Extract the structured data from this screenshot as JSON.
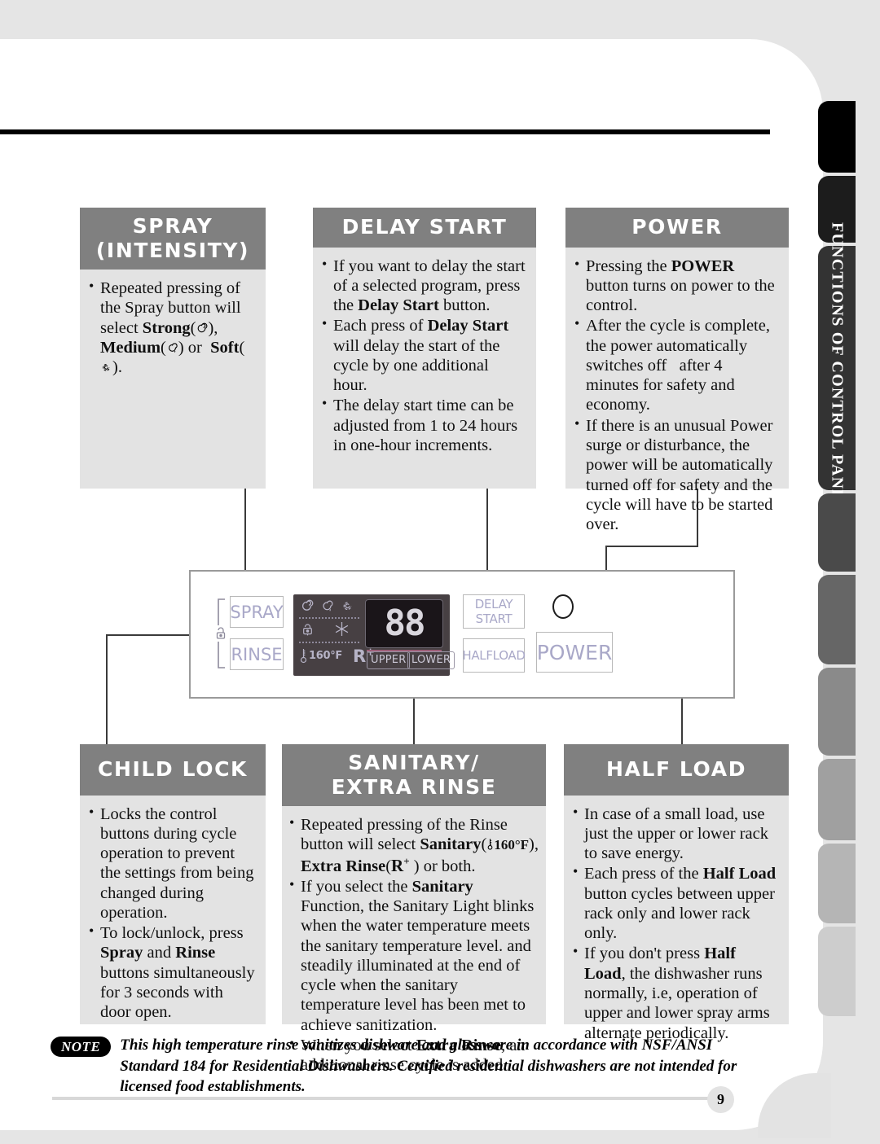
{
  "sidebar": {
    "active_tab_label": "FUNCTIONS OF CONTROL PANEL",
    "tabs": [
      {
        "name": "tab-1",
        "color": "#000000"
      },
      {
        "name": "tab-2",
        "color": "#1c1c1c"
      },
      {
        "name": "tab-3-active",
        "color": "#333333"
      },
      {
        "name": "tab-4",
        "color": "#4a4a4a"
      },
      {
        "name": "tab-5",
        "color": "#666666"
      },
      {
        "name": "tab-6",
        "color": "#8a8a8a"
      },
      {
        "name": "tab-7",
        "color": "#a0a0a0"
      },
      {
        "name": "tab-8",
        "color": "#b5b5b5"
      },
      {
        "name": "tab-9",
        "color": "#cdcdcd"
      }
    ]
  },
  "boxes": {
    "spray": {
      "title_line1": "SPRAY",
      "title_line2": "(INTENSITY)",
      "bullets": [
        {
          "segments": [
            {
              "t": "Repeated pressing of the Spray button will select ",
              "b": false
            },
            {
              "t": "Strong",
              "b": true
            },
            {
              "t": "(",
              "b": true,
              "icon": "spiral-strong-icon"
            },
            {
              "t": "), ",
              "b": true
            },
            {
              "t": "Medium",
              "b": true
            },
            {
              "t": "(",
              "b": true,
              "icon": "spiral-medium-icon"
            },
            {
              "t": ") or ",
              "b": true
            },
            {
              "t": "Soft",
              "b": true
            },
            {
              "t": "(",
              "b": true,
              "icon": "spiral-soft-icon"
            },
            {
              "t": ").",
              "b": true
            }
          ]
        }
      ]
    },
    "delay_start": {
      "title": "DELAY START",
      "bullets": [
        {
          "segments": [
            {
              "t": "If you want to delay the start of a selected program, press the ",
              "b": false
            },
            {
              "t": "Delay Start",
              "b": true
            },
            {
              "t": " button.",
              "b": false
            }
          ]
        },
        {
          "segments": [
            {
              "t": "Each press of ",
              "b": false
            },
            {
              "t": "Delay Start",
              "b": true
            },
            {
              "t": " will delay the start of the cycle by one additional hour.",
              "b": false
            }
          ]
        },
        {
          "segments": [
            {
              "t": "The delay start time can be adjusted from 1 to 24 hours in one-hour increments.",
              "b": false
            }
          ]
        }
      ]
    },
    "power": {
      "title": "POWER",
      "bullets": [
        {
          "segments": [
            {
              "t": "Pressing the ",
              "b": false
            },
            {
              "t": "POWER",
              "b": true
            },
            {
              "t": " button turns on power to the control.",
              "b": false
            }
          ]
        },
        {
          "segments": [
            {
              "t": "After the cycle is complete, the power automatically switches off   after 4 minutes for safety and economy.",
              "b": false
            }
          ]
        },
        {
          "segments": [
            {
              "t": "If there is an unusual Power surge or disturbance, the power will be automatically  turned off for safety and the cycle will have to be started over.",
              "b": false
            }
          ]
        }
      ]
    },
    "child_lock": {
      "title": "CHILD LOCK",
      "bullets": [
        {
          "segments": [
            {
              "t": "Locks the control buttons during cycle operation to prevent the settings from being changed during operation.",
              "b": false
            }
          ]
        },
        {
          "segments": [
            {
              "t": "To lock/unlock, press ",
              "b": false
            },
            {
              "t": "Spray",
              "b": true
            },
            {
              "t": " and ",
              "b": false
            },
            {
              "t": "Rinse",
              "b": true
            },
            {
              "t": " buttons simultaneously for 3 seconds with door open.",
              "b": false
            }
          ]
        }
      ]
    },
    "sanitary": {
      "title_line1": "SANITARY/",
      "title_line2": "EXTRA RINSE",
      "bullets": [
        {
          "segments": [
            {
              "t": "Repeated pressing of the Rinse button will select ",
              "b": false
            },
            {
              "t": "Sanitary",
              "b": true
            },
            {
              "t": "(",
              "b": true,
              "icon": "thermometer-160f-icon"
            },
            {
              "t": "), ",
              "b": true
            },
            {
              "t": "Extra Rinse",
              "b": true
            },
            {
              "t": "(",
              "b": true,
              "icon": "r-plus-icon"
            },
            {
              "t": " ) or both.",
              "b": false
            }
          ]
        },
        {
          "segments": [
            {
              "t": "If you select the ",
              "b": false
            },
            {
              "t": "Sanitary",
              "b": true
            },
            {
              "t": " Function, the Sanitary Light blinks when the water temperature meets the sanitary temperature level. and steadily illuminated at the end of cycle when the sanitary temperature level has been met to achieve sanitization.",
              "b": false
            }
          ]
        },
        {
          "segments": [
            {
              "t": "When you select ",
              "b": false
            },
            {
              "t": "Extra Rinse",
              "b": true
            },
            {
              "t": ", an additional rinse cycle is added.",
              "b": false
            }
          ]
        }
      ]
    },
    "half_load": {
      "title": "HALF LOAD",
      "bullets": [
        {
          "segments": [
            {
              "t": "In case of a small load, use just the upper or lower rack to save energy.",
              "b": false
            }
          ]
        },
        {
          "segments": [
            {
              "t": "Each press of the ",
              "b": false
            },
            {
              "t": "Half Load",
              "b": true
            },
            {
              "t": " button cycles between upper rack only and lower rack only.",
              "b": false
            }
          ]
        },
        {
          "segments": [
            {
              "t": "If you don't press ",
              "b": false
            },
            {
              "t": "Half Load",
              "b": true
            },
            {
              "t": ", the dishwasher runs normally, i.e, operation of upper and lower spray arms alternate periodically.",
              "b": false
            }
          ]
        }
      ]
    }
  },
  "control_panel": {
    "buttons": {
      "spray": "SPRAY",
      "rinse": "RINSE",
      "delay_start": "DELAY START",
      "half_load": "HALFLOAD",
      "power": "POWER"
    },
    "display": {
      "digits": "88",
      "temperature_label": "160°F",
      "extra_rinse_label": "R",
      "extra_rinse_sup": "+",
      "upper_label": "UPPER",
      "lower_label": "LOWER"
    }
  },
  "note": {
    "badge": "NOTE",
    "text": "This high temperature rinse sanitizes dishware and glassware in accordance with NSF/ANSI Standard 184 for Residential Dishwashers. Certified residential dishwashers are not intended for licensed food establishments."
  },
  "footer": {
    "page_number": "9"
  },
  "colors": {
    "header_gray": "#808080",
    "body_gray": "#e3e3e3",
    "panel_text": "#a9a8c8",
    "lcd_bg": "#474043"
  }
}
